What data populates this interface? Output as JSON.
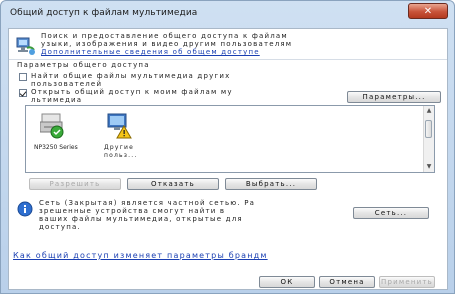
{
  "window": {
    "title": "Общий доступ к файлам мультимедиа",
    "close_label": "✕"
  },
  "header": {
    "description": "Поиск и предоставление общего доступа к файлам",
    "description_line2": "узыки, изображения и видео другим пользователям",
    "more_link": "Дополнительные сведения об общем доступе"
  },
  "settings": {
    "section_label": "Параметры общего доступа",
    "find_shared_checkbox": "Найти общие файлы мультимедиа других",
    "find_shared_checkbox_line2": "пользователей",
    "share_my_checkbox": "Открыть общий доступ к моим файлам му",
    "share_my_checkbox_line2": "льтимедиа",
    "parameters_button": "Параметры..."
  },
  "devices": [
    {
      "label": "NP3250 Series",
      "icon": "printer-check-icon"
    },
    {
      "label": "Другие",
      "label2": "польз...",
      "icon": "computer-warning-icon"
    }
  ],
  "device_actions": {
    "allow": "Разрешить",
    "deny": "Отказать",
    "customize": "Выбрать..."
  },
  "network_info": {
    "text_line1": "Сеть (Закрытая) является частной сетью. Ра",
    "text_line2": "зрешенные устройства смогут найти в",
    "text_line3": "ваших файлы мультимедиа, открытые для",
    "text_line4": "доступа.",
    "network_button": "Сеть..."
  },
  "footer": {
    "firewall_link": "Как общий доступ изменяет параметры брандм",
    "ok": "ОК",
    "cancel": "Отмена",
    "apply": "Применить"
  },
  "colors": {
    "link": "#1a3fb2",
    "title_bg": "#c3d7ee",
    "close_red": "#c8533a"
  }
}
